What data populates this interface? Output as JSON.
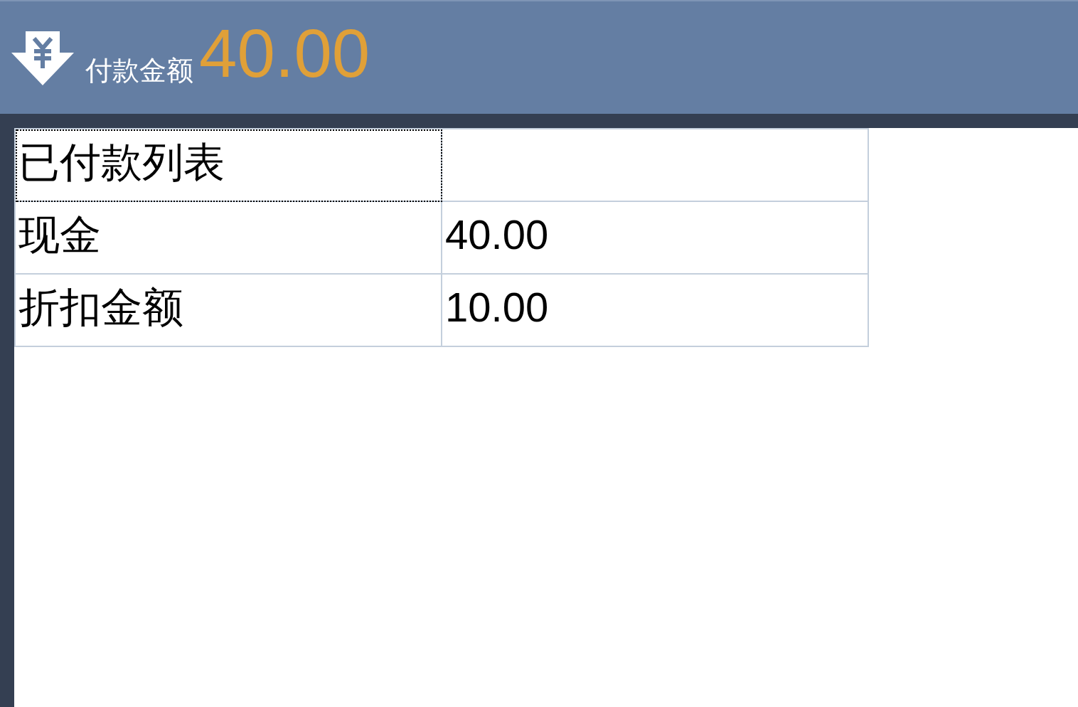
{
  "header": {
    "label": "付款金额",
    "amount": "40.00"
  },
  "table": {
    "title": {
      "text": "已付款列表",
      "focused": true
    },
    "rows": [
      {
        "name": "现金",
        "amount": "40.00"
      },
      {
        "name": "折扣金额",
        "amount": "10.00"
      }
    ]
  }
}
